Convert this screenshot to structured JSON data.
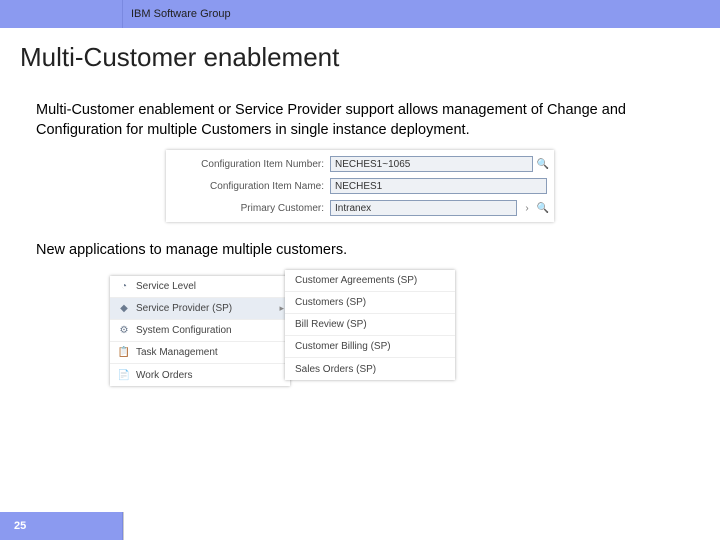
{
  "header": {
    "group": "IBM Software Group"
  },
  "title": "Multi-Customer enablement",
  "paragraph1": "Multi-Customer enablement or Service Provider support allows management of Change and Configuration for multiple Customers in single instance deployment.",
  "paragraph2": "New applications to manage multiple customers.",
  "form": {
    "rows": [
      {
        "label": "Configuration Item Number:",
        "value": "NECHES1~1065"
      },
      {
        "label": "Configuration Item Name:",
        "value": "NECHES1"
      },
      {
        "label": "Primary Customer:",
        "value": "Intranex"
      }
    ]
  },
  "leftMenu": {
    "items": [
      {
        "icon": "◔",
        "label": "Service Level"
      },
      {
        "icon": "◆",
        "label": "Service Provider (SP)",
        "selected": true,
        "caret": "▸"
      },
      {
        "icon": "⚙",
        "label": "System Configuration"
      },
      {
        "icon": "📋",
        "label": "Task Management"
      },
      {
        "icon": "📄",
        "label": "Work Orders"
      }
    ]
  },
  "rightMenu": {
    "items": [
      {
        "label": "Customer Agreements (SP)"
      },
      {
        "label": "Customers (SP)"
      },
      {
        "label": "Bill Review (SP)"
      },
      {
        "label": "Customer Billing (SP)"
      },
      {
        "label": "Sales Orders (SP)"
      }
    ]
  },
  "footer": {
    "page": "25"
  }
}
